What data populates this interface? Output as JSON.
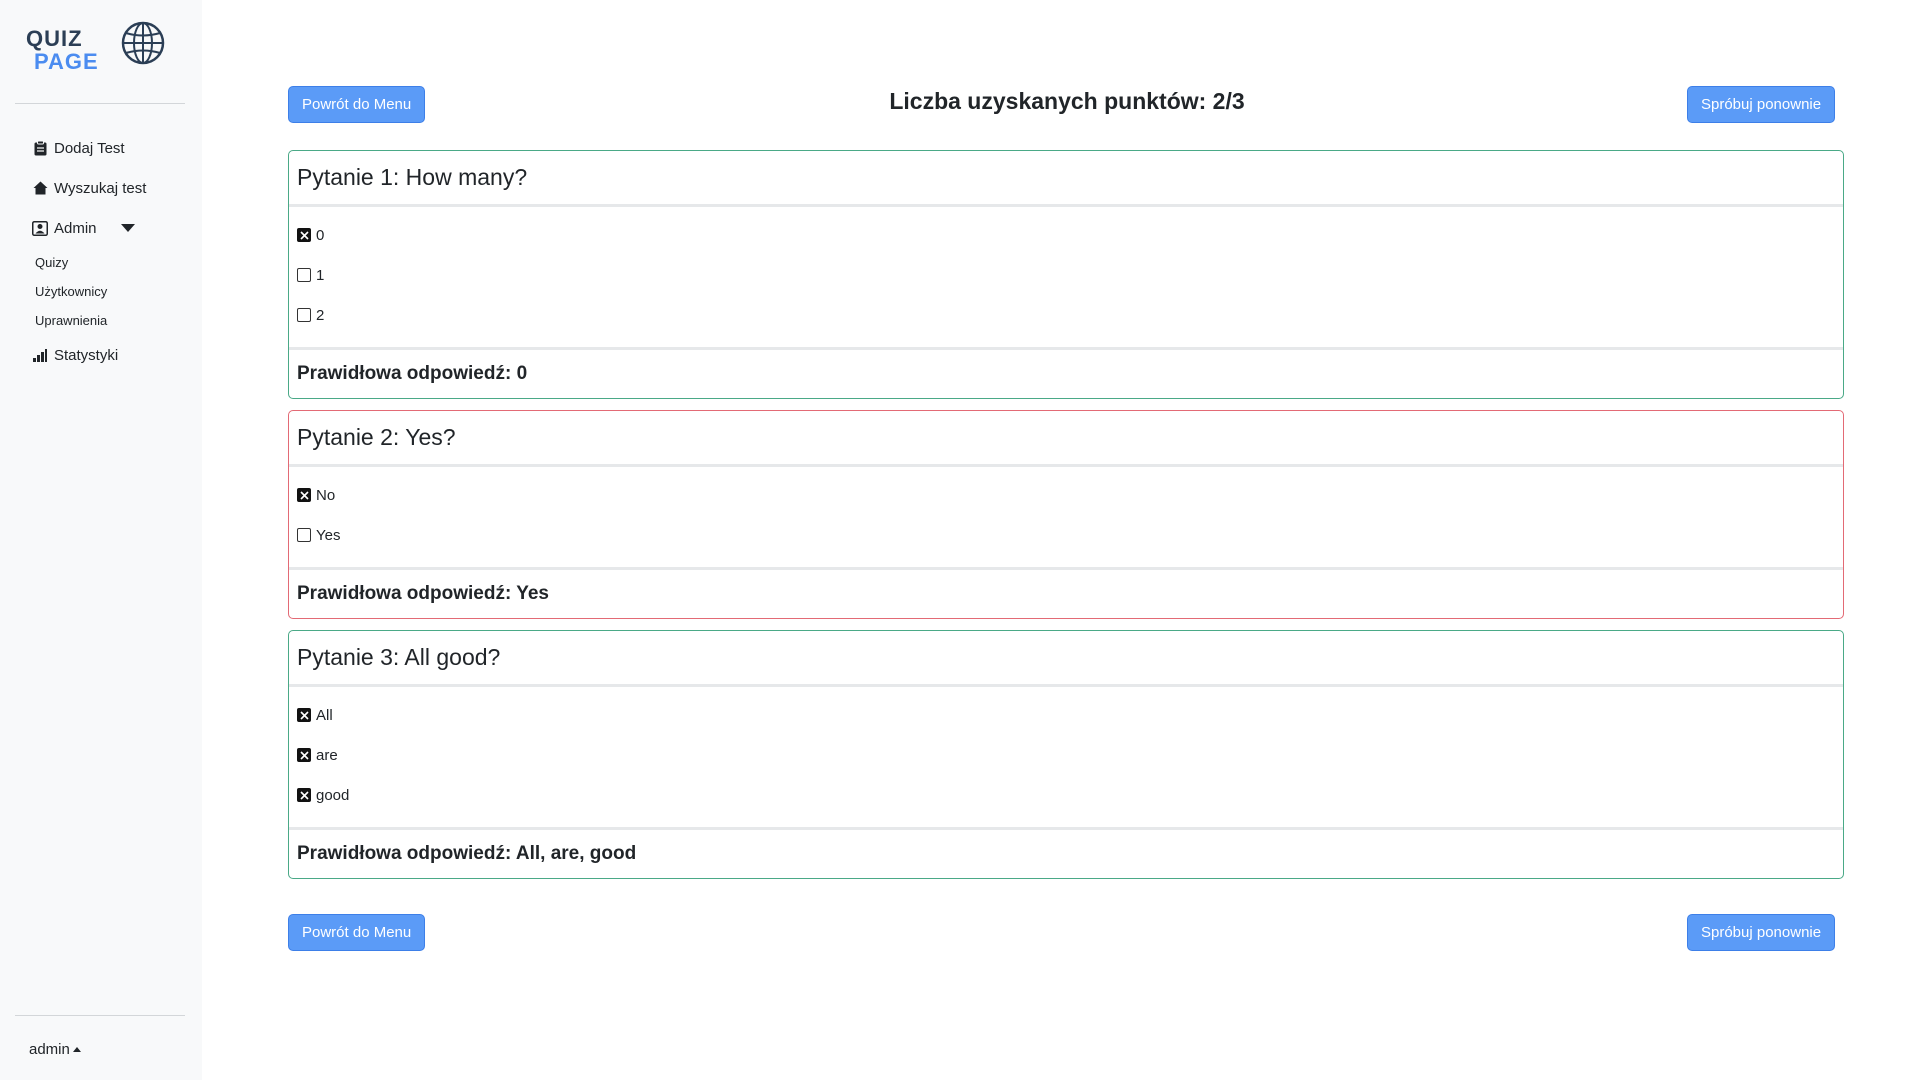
{
  "sidebar": {
    "logo_line1": "QUIZ",
    "logo_line2": "PAGE",
    "items": [
      {
        "label": "Dodaj Test",
        "icon": "clipboard-icon"
      },
      {
        "label": "Wyszukaj test",
        "icon": "home-icon"
      },
      {
        "label": "Admin",
        "icon": "person-badge-icon"
      }
    ],
    "admin_sub": [
      {
        "label": "Quizy"
      },
      {
        "label": "Użytkownicy"
      },
      {
        "label": "Uprawnienia"
      }
    ],
    "stats": {
      "label": "Statystyki",
      "icon": "bar-chart-icon"
    },
    "user": "admin"
  },
  "header": {
    "back_label": "Powrót do Menu",
    "retry_label": "Spróbuj ponownie",
    "score": "Liczba uzyskanych punktów: 2/3"
  },
  "questions": [
    {
      "title": "Pytanie 1: How many?",
      "status": "correct",
      "options": [
        {
          "label": "0",
          "checked": true
        },
        {
          "label": "1",
          "checked": false
        },
        {
          "label": "2",
          "checked": false
        }
      ],
      "answer": "Prawidłowa odpowiedź: 0"
    },
    {
      "title": "Pytanie 2: Yes?",
      "status": "incorrect",
      "options": [
        {
          "label": "No",
          "checked": true
        },
        {
          "label": "Yes",
          "checked": false
        }
      ],
      "answer": "Prawidłowa odpowiedź: Yes"
    },
    {
      "title": "Pytanie 3: All good?",
      "status": "correct",
      "options": [
        {
          "label": "All",
          "checked": true
        },
        {
          "label": "are",
          "checked": true
        },
        {
          "label": "good",
          "checked": true
        }
      ],
      "answer": "Prawidłowa odpowiedź: All, are, good"
    }
  ],
  "footer": {
    "back_label": "Powrót do Menu",
    "retry_label": "Spróbuj ponownie"
  },
  "colors": {
    "accent": "#5b9bf7",
    "correct_border": "#4aa987",
    "incorrect_border": "#e36a75",
    "sidebar_bg": "#f8f9fa"
  }
}
